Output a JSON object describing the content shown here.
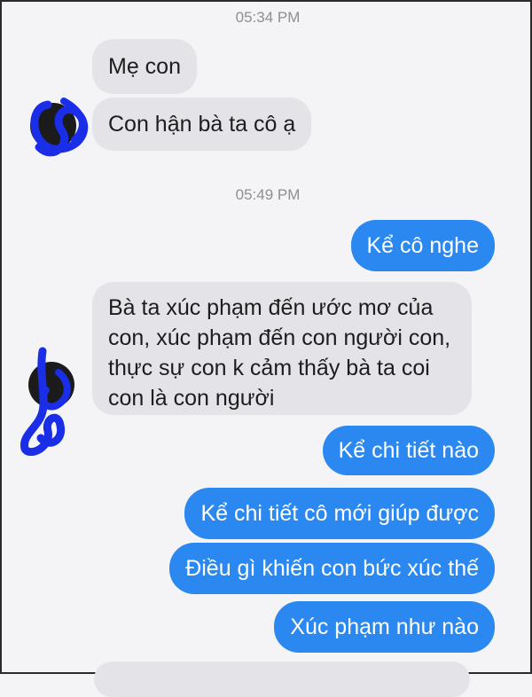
{
  "colors": {
    "outgoing": "#2a88f0",
    "incoming": "#e4e4e8",
    "timestamp": "#8e8e93",
    "scribble": "#1a2ee8"
  },
  "timestamps": [
    "05:34 PM",
    "05:49 PM"
  ],
  "messages": [
    {
      "from": "other",
      "text": "Mẹ con"
    },
    {
      "from": "other",
      "text": "Con hận bà ta cô ạ"
    },
    {
      "from": "me",
      "text": "Kể cô nghe"
    },
    {
      "from": "other",
      "text": "Bà ta xúc phạm đến ước mơ của con, xúc phạm đến con người con, thực sự con k cảm thấy bà ta coi con là con người"
    },
    {
      "from": "me",
      "text": "Kể chi tiết nào"
    },
    {
      "from": "me",
      "text": "Kể chi tiết cô mới giúp được"
    },
    {
      "from": "me",
      "text": "Điều gì khiến con bức xúc thế"
    },
    {
      "from": "me",
      "text": "Xúc phạm như nào"
    }
  ],
  "avatars": [
    {
      "name": "contact-avatar",
      "state": "redacted with blue scribble"
    },
    {
      "name": "contact-avatar",
      "state": "redacted with blue scribble"
    }
  ]
}
